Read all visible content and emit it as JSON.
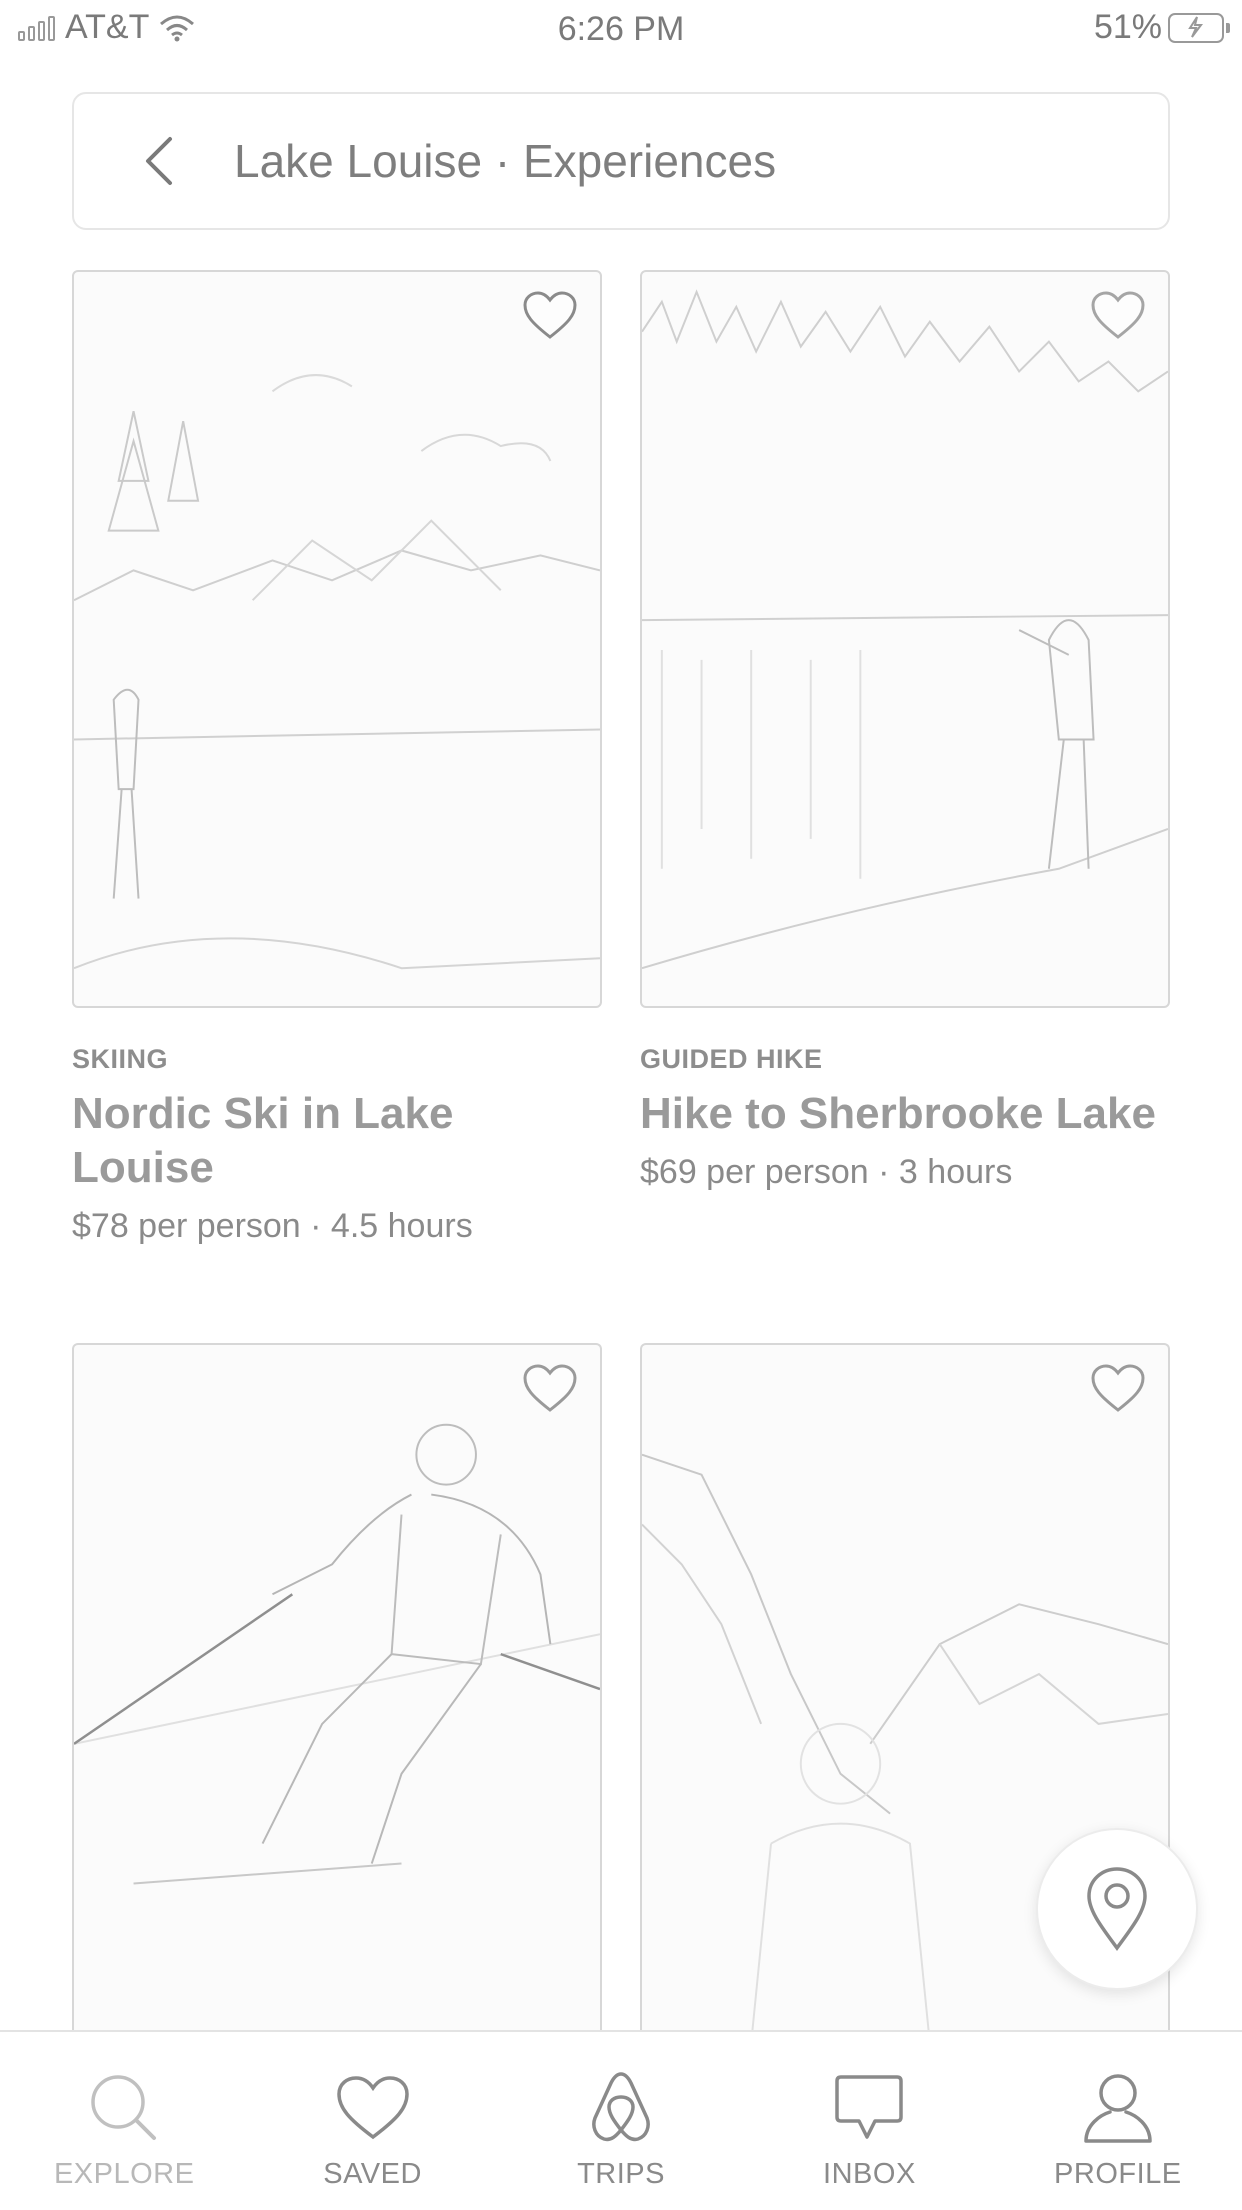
{
  "status_bar": {
    "carrier": "AT&T",
    "time": "6:26 PM",
    "battery_percent": "51%",
    "icons": [
      "signal-icon",
      "wifi-icon",
      "battery-charging-icon"
    ]
  },
  "header": {
    "title": "Lake Louise · Experiences",
    "back_icon": "chevron-left-icon"
  },
  "listings": [
    {
      "category": "SKIING",
      "title": "Nordic Ski in Lake Louise",
      "price_line": "$78 per person · 4.5 hours",
      "image": "nordic skier overlooking frozen lake",
      "saved": false
    },
    {
      "category": "GUIDED HIKE",
      "title": "Hike to Sherbrooke Lake",
      "price_line": "$69 per person · 3 hours",
      "image": "hiker by forested lake",
      "saved": false
    },
    {
      "image": "downhill skier",
      "saved": false
    },
    {
      "image": "hiker in mountain valley",
      "saved": false
    }
  ],
  "map_button": {
    "icon": "map-pin-icon"
  },
  "tabbar": {
    "active": "EXPLORE",
    "tabs": [
      {
        "label": "EXPLORE",
        "icon": "search-icon"
      },
      {
        "label": "SAVED",
        "icon": "heart-icon"
      },
      {
        "label": "TRIPS",
        "icon": "airbnb-logo-icon"
      },
      {
        "label": "INBOX",
        "icon": "message-icon"
      },
      {
        "label": "PROFILE",
        "icon": "user-icon"
      }
    ]
  }
}
